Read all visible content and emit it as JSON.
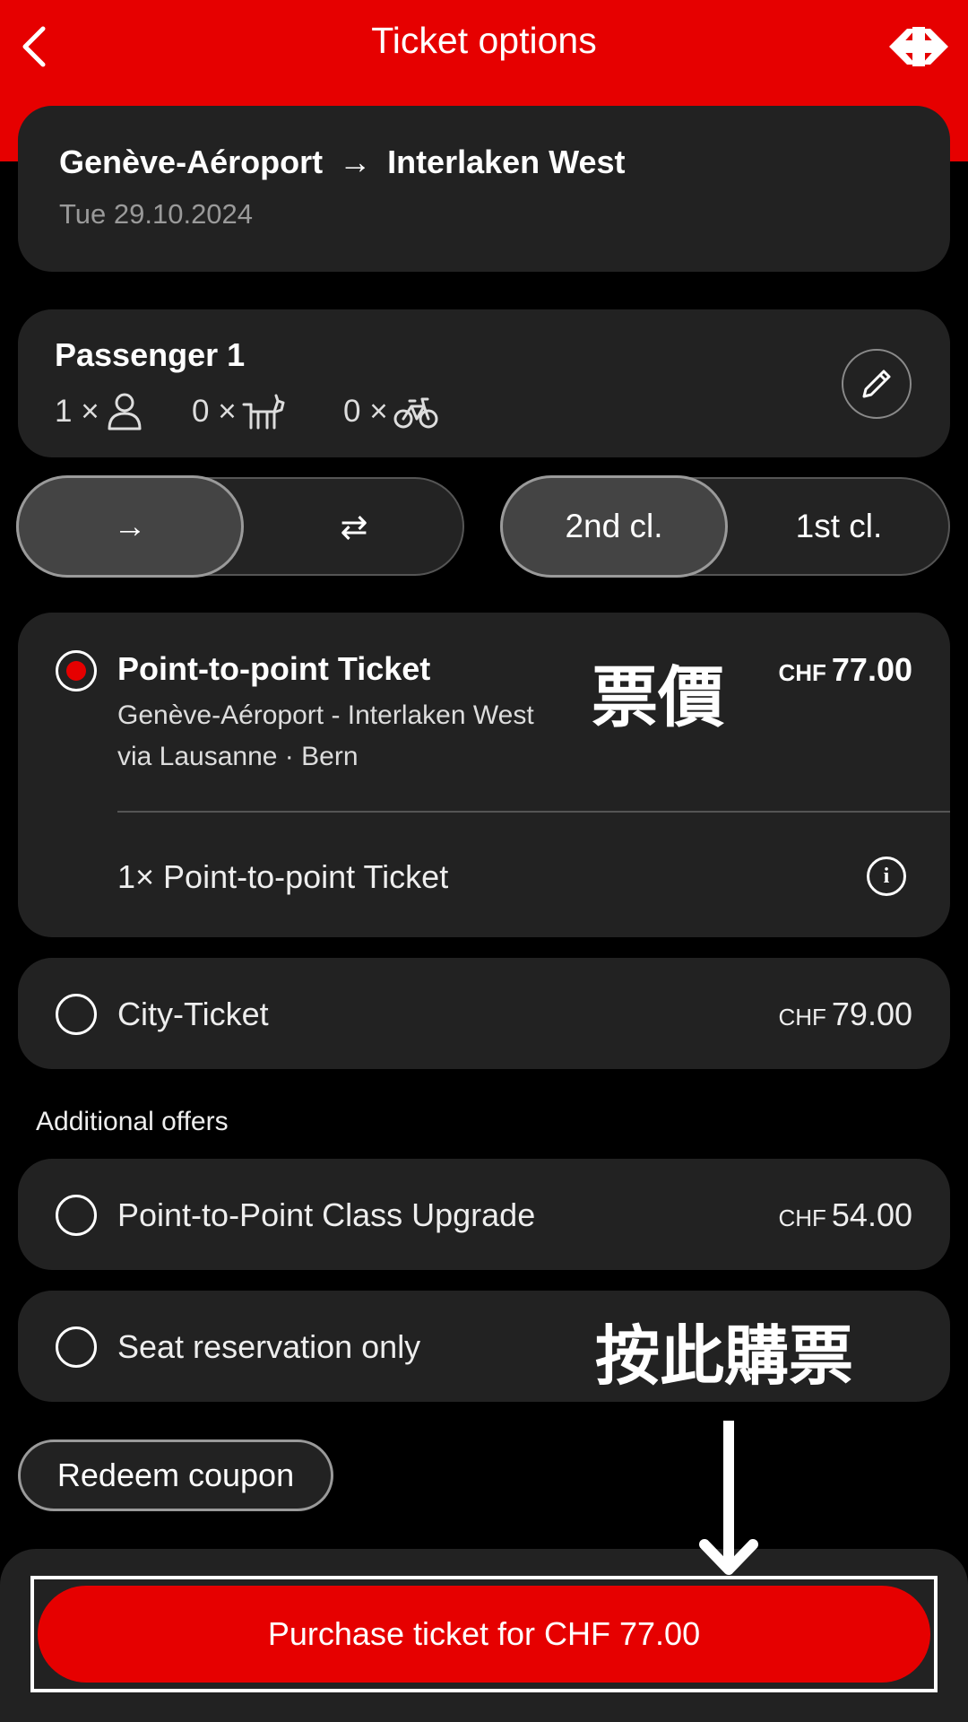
{
  "header": {
    "title": "Ticket options",
    "back_icon": "chevron-left-icon",
    "logo_icon": "sbb-logo-icon",
    "color": "#e60000"
  },
  "journey": {
    "from": "Genève-Aéroport",
    "arrow": "→",
    "to": "Interlaken West",
    "date": "Tue 29.10.2024"
  },
  "passenger": {
    "name": "Passenger 1",
    "adults": "1 ×",
    "dogs": "0 ×",
    "bikes": "0 ×",
    "edit_icon": "pencil-icon"
  },
  "trip_type": {
    "one_way": "→",
    "return": "⇄",
    "selected": "one_way"
  },
  "travel_class": {
    "second": "2nd cl.",
    "first": "1st cl.",
    "selected": "second"
  },
  "offers": [
    {
      "title": "Point-to-point Ticket",
      "route": "Genève-Aéroport - Interlaken West",
      "via": "via Lausanne · Bern",
      "currency": "CHF",
      "price": "77.00",
      "detail": "1× Point-to-point Ticket",
      "selected": true
    },
    {
      "title": "City-Ticket",
      "currency": "CHF",
      "price": "79.00",
      "selected": false
    }
  ],
  "additional": {
    "heading": "Additional offers",
    "items": [
      {
        "title": "Point-to-Point Class Upgrade",
        "currency": "CHF",
        "price": "54.00"
      },
      {
        "title": "Seat reservation only"
      }
    ]
  },
  "coupon_label": "Redeem coupon",
  "purchase_label": "Purchase ticket for CHF 77.00",
  "annotations": {
    "price_note": "票價",
    "buy_note": "按此購票"
  }
}
